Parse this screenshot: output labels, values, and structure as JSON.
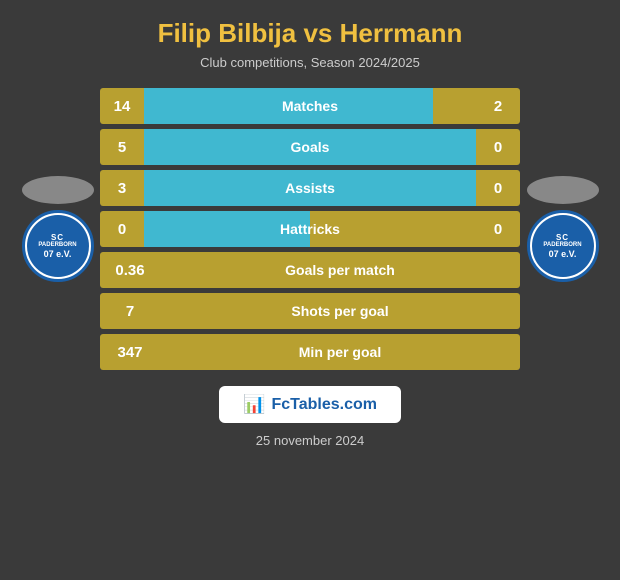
{
  "header": {
    "title": "Filip Bilbija vs Herrmann",
    "subtitle": "Club competitions, Season 2024/2025"
  },
  "stats": [
    {
      "id": "matches",
      "label": "Matches",
      "left_val": "14",
      "right_val": "2",
      "fill_pct": 87
    },
    {
      "id": "goals",
      "label": "Goals",
      "left_val": "5",
      "right_val": "0",
      "fill_pct": 100
    },
    {
      "id": "assists",
      "label": "Assists",
      "left_val": "3",
      "right_val": "0",
      "fill_pct": 100
    },
    {
      "id": "hattricks",
      "label": "Hattricks",
      "left_val": "0",
      "right_val": "0",
      "fill_pct": 50
    },
    {
      "id": "goals_per_match",
      "label": "Goals per match",
      "left_val": "0.36",
      "fill_pct": 0
    },
    {
      "id": "shots_per_goal",
      "label": "Shots per goal",
      "left_val": "7",
      "fill_pct": 0
    },
    {
      "id": "min_per_goal",
      "label": "Min per goal",
      "left_val": "347",
      "fill_pct": 0
    }
  ],
  "logo_left": {
    "line1": "SC",
    "line2": "PADERBORN",
    "line3": "07 e.V."
  },
  "logo_right": {
    "line1": "SC",
    "line2": "PADERBORN",
    "line3": "07 e.V."
  },
  "fctables": {
    "text": "FcTables.com"
  },
  "date": {
    "text": "25 november 2024"
  }
}
